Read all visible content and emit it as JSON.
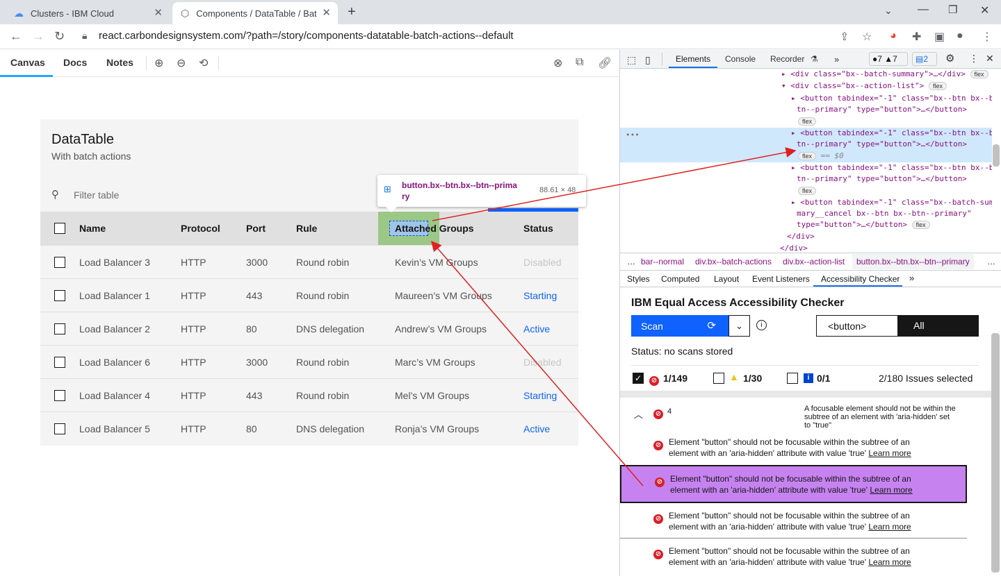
{
  "browser": {
    "tabs": [
      {
        "title": "Clusters - IBM Cloud"
      },
      {
        "title": "Components / DataTable / Bat"
      }
    ],
    "url": "react.carbondesignsystem.com/?path=/story/components-datatable-batch-actions--default"
  },
  "storybook": {
    "tabs": [
      "Canvas",
      "Docs",
      "Notes"
    ]
  },
  "datatable": {
    "title": "DataTable",
    "subtitle": "With batch actions",
    "filter_placeholder": "Filter table",
    "headers": [
      "Name",
      "Protocol",
      "Port",
      "Rule",
      "Attached Groups",
      "Status"
    ],
    "rows": [
      {
        "name": "Load Balancer 3",
        "protocol": "HTTP",
        "port": "3000",
        "rule": "Round robin",
        "groups": "Kevin’s VM Groups",
        "status": "Disabled"
      },
      {
        "name": "Load Balancer 1",
        "protocol": "HTTP",
        "port": "443",
        "rule": "Round robin",
        "groups": "Maureen’s VM Groups",
        "status": "Starting"
      },
      {
        "name": "Load Balancer 2",
        "protocol": "HTTP",
        "port": "80",
        "rule": "DNS delegation",
        "groups": "Andrew’s VM Groups",
        "status": "Active"
      },
      {
        "name": "Load Balancer 6",
        "protocol": "HTTP",
        "port": "3000",
        "rule": "Round robin",
        "groups": "Marc’s VM Groups",
        "status": "Disabled"
      },
      {
        "name": "Load Balancer 4",
        "protocol": "HTTP",
        "port": "443",
        "rule": "Round robin",
        "groups": "Mel’s VM Groups",
        "status": "Starting"
      },
      {
        "name": "Load Balancer 5",
        "protocol": "HTTP",
        "port": "80",
        "rule": "DNS delegation",
        "groups": "Ronja’s VM Groups",
        "status": "Active"
      }
    ]
  },
  "tooltip": {
    "selector_line1": "button.bx--btn.bx--btn--prima",
    "selector_line2": "ry",
    "size": "88.61 × 48"
  },
  "devtools": {
    "tabs": [
      "Elements",
      "Console",
      "Recorder"
    ],
    "badges": {
      "errors": "7",
      "warnings": "7",
      "messages": "2"
    },
    "dom_lines": [
      "<div class=\"bx--batch-summary\">…</div>",
      "<div class=\"bx--action-list\">",
      "<button tabindex=\"-1\" class=\"bx--btn bx--b",
      "tn--primary\" type=\"button\">…</button>",
      "<button tabindex=\"-1\" class=\"bx--btn bx--b",
      "tn--primary\" type=\"button\">…</button>",
      "== $0",
      "<button tabindex=\"-1\" class=\"bx--btn bx--b",
      "tn--primary\" type=\"button\">…</button>",
      "<button tabindex=\"-1\" class=\"bx--batch-sum",
      "mary__cancel bx--btn bx--btn--primary\"",
      "type=\"button\">…</button>",
      "</div>",
      "</div>"
    ],
    "flex_label": "flex",
    "crumbs": [
      "…",
      "bar--normal",
      "div.bx--batch-actions",
      "div.bx--action-list",
      "button.bx--btn.bx--btn--primary",
      "…"
    ],
    "subtabs": [
      "Styles",
      "Computed",
      "Layout",
      "Event Listeners",
      "Accessibility Checker"
    ],
    "checker": {
      "title": "IBM Equal Access Accessibility Checker",
      "scan_label": "Scan",
      "scope_value": "<button>",
      "all_label": "All",
      "status": "Status: no scans stored",
      "counts": {
        "violations": "1/149",
        "review": "1/30",
        "recommend": "0/1"
      },
      "selected": "2/180 Issues selected",
      "group_count": "4",
      "group_text": "A focusable element should not be within the subtree of an element with 'aria-hidden' set to \"true\"",
      "issue_text_1": "Element \"button\" should not be focusable within the subtree of an",
      "issue_text_2": "element with an 'aria-hidden' attribute with value 'true'",
      "learn_more": "Learn more"
    }
  },
  "colors": {
    "carbon_blue": "#0f62fe",
    "highlight_purple": "#c683f0",
    "devtools_select": "#cfe8fc",
    "error_red": "#da1e28"
  }
}
